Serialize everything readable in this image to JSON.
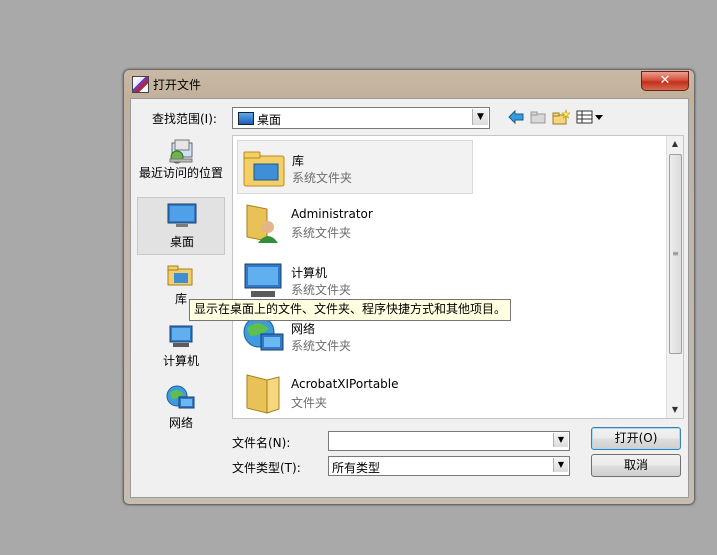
{
  "window": {
    "title": "打开文件",
    "close_glyph": "✕"
  },
  "toolbar": {
    "look_in_label": "查找范围(I):",
    "look_in_value": "桌面",
    "back_icon": "back-arrow-icon",
    "up_icon": "up-folder-icon",
    "new_folder_icon": "new-folder-icon",
    "view_icon": "view-menu-icon"
  },
  "places": [
    {
      "label": "最近访问的位置",
      "icon": "recent-places-icon"
    },
    {
      "label": "桌面",
      "icon": "desktop-icon"
    },
    {
      "label": "库",
      "icon": "libraries-icon"
    },
    {
      "label": "计算机",
      "icon": "computer-icon"
    },
    {
      "label": "网络",
      "icon": "network-icon"
    }
  ],
  "files": [
    {
      "name": "库",
      "type": "系统文件夹"
    },
    {
      "name": "Administrator",
      "type": "系统文件夹"
    },
    {
      "name": "计算机",
      "type": "系统文件夹"
    },
    {
      "name": "网络",
      "type": "系统文件夹"
    },
    {
      "name": "AcrobatXIPortable",
      "type": "文件夹"
    }
  ],
  "tooltip": "显示在桌面上的文件、文件夹、程序快捷方式和其他项目。",
  "bottom": {
    "filename_label": "文件名(N):",
    "filename_value": "",
    "filetype_label": "文件类型(T):",
    "filetype_value": "所有类型",
    "open_label": "打开(O)",
    "cancel_label": "取消"
  },
  "colors": {
    "accent_blue": "#1e5fb4",
    "tooltip_bg": "#ffffe1",
    "close_red": "#c2301c"
  }
}
